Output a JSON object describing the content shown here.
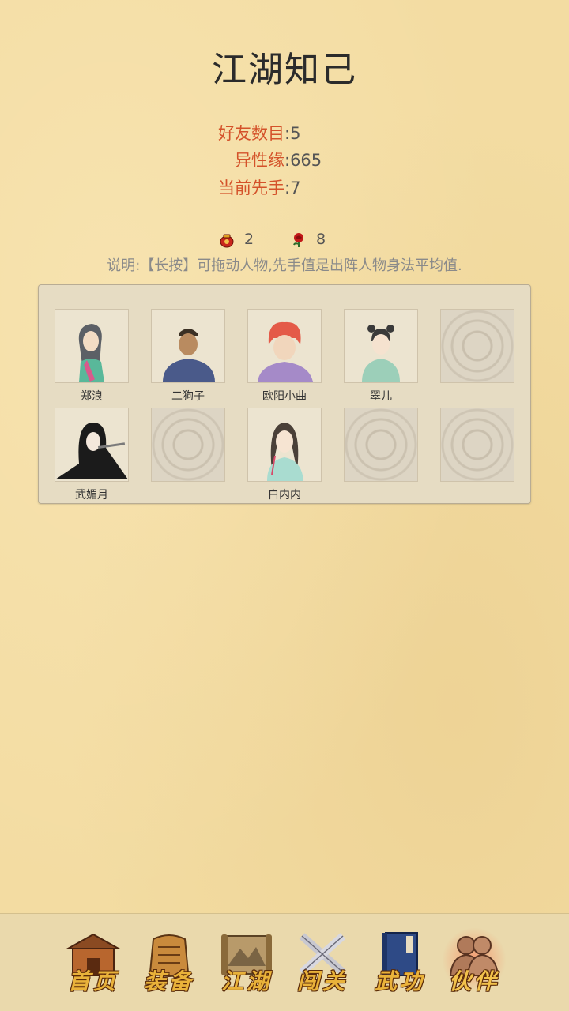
{
  "title": "江湖知己",
  "stats": [
    {
      "label": "好友数目",
      "value": ":5"
    },
    {
      "label": "异性缘",
      "value": ":665"
    },
    {
      "label": "当前先手",
      "value": ":7"
    }
  ],
  "counters": [
    {
      "icon": "red-pouch-icon",
      "value": "2"
    },
    {
      "icon": "red-rose-icon",
      "value": "8"
    }
  ],
  "description": "说明:【长按】可拖动人物,先手值是出阵人物身法平均值.",
  "characters": [
    {
      "name": "郑浪",
      "empty": false
    },
    {
      "name": "二狗子",
      "empty": false
    },
    {
      "name": "欧阳小曲",
      "empty": false
    },
    {
      "name": "翠儿",
      "empty": false
    },
    {
      "name": "",
      "empty": true
    },
    {
      "name": "武媚月",
      "empty": false
    },
    {
      "name": "",
      "empty": true
    },
    {
      "name": "白内内",
      "empty": false
    },
    {
      "name": "",
      "empty": true
    },
    {
      "name": "",
      "empty": true
    }
  ],
  "nav": [
    {
      "label": "首页",
      "icon": "house-icon",
      "active": false
    },
    {
      "label": "装备",
      "icon": "armor-icon",
      "active": false
    },
    {
      "label": "江湖",
      "icon": "scroll-map-icon",
      "active": false
    },
    {
      "label": "闯关",
      "icon": "crossed-swords-icon",
      "active": false
    },
    {
      "label": "武功",
      "icon": "book-icon",
      "active": false
    },
    {
      "label": "伙伴",
      "icon": "companions-icon",
      "active": true
    }
  ],
  "colors": {
    "background": "#f3dca2",
    "stat_label": "#d4522a",
    "nav_label": "#e9b23a"
  }
}
